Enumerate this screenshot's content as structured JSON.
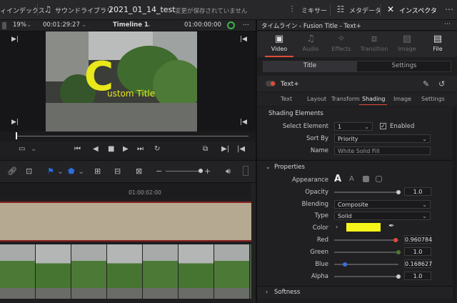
{
  "topbar": {
    "media_index": "ィインデックス",
    "sound_library": "サウンドライブラリ",
    "project_name": "2021_01_14_test",
    "save_status": "変更が保存されていません",
    "mixer": "ミキサー",
    "metadata": "メタデータ",
    "inspector": "インスペクタ"
  },
  "viewer": {
    "zoom": "19%",
    "timecode_left": "00:01:29:27",
    "timeline_name": "Timeline 1",
    "timecode_right": "01:00:00:00",
    "overlay_c": "C",
    "overlay_text": "ustom Title"
  },
  "timeline": {
    "ruler_time": "01:00:02:00"
  },
  "inspector": {
    "header_title": "タイムライン - Fusion Title - Text+",
    "tabs": [
      {
        "label": "Video",
        "icon": "video-icon",
        "active": true
      },
      {
        "label": "Audio",
        "icon": "audio-icon",
        "active": false
      },
      {
        "label": "Effects",
        "icon": "effects-icon",
        "active": false
      },
      {
        "label": "Transition",
        "icon": "transition-icon",
        "active": false
      },
      {
        "label": "Image",
        "icon": "image-icon",
        "active": false
      },
      {
        "label": "File",
        "icon": "file-icon",
        "active": true
      }
    ],
    "sub_tabs": {
      "title": "Title",
      "settings": "Settings"
    },
    "plugin_name": "Text+",
    "text_tabs": [
      "Text",
      "Layout",
      "Transform",
      "Shading",
      "Image",
      "Settings"
    ],
    "shading": {
      "section_title": "Shading Elements",
      "select_element_label": "Select Element",
      "select_element_value": "1",
      "enabled_label": "Enabled",
      "sort_by_label": "Sort By",
      "sort_by_value": "Priority",
      "name_label": "Name",
      "name_value": "White Solid Fill"
    },
    "properties": {
      "section_title": "Properties",
      "appearance_label": "Appearance",
      "opacity_label": "Opacity",
      "opacity_value": "1.0",
      "opacity_level": 1.0,
      "blending_label": "Blending",
      "blending_value": "Composite",
      "type_label": "Type",
      "type_value": "Solid",
      "color_label": "Color",
      "color_swatch": "#f5f51a",
      "red_label": "Red",
      "red_value": "0.960784",
      "red_level": 0.960784,
      "green_label": "Green",
      "green_value": "1.0",
      "green_level": 1.0,
      "blue_label": "Blue",
      "blue_value": "0.168627",
      "blue_level": 0.168627,
      "alpha_label": "Alpha",
      "alpha_value": "1.0",
      "alpha_level": 1.0
    },
    "softness_label": "Softness"
  },
  "colors": {
    "accent": "#e04b3a",
    "title_yellow": "#e8e81a"
  }
}
